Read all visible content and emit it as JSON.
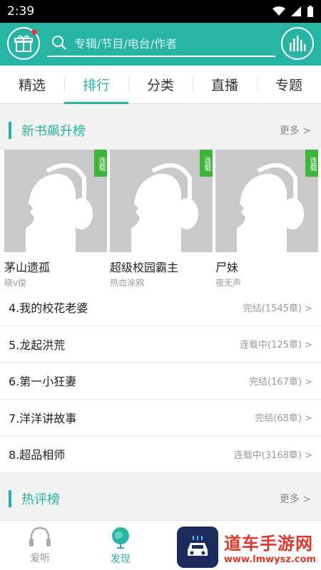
{
  "status": {
    "time": "2:39"
  },
  "search": {
    "placeholder": "专辑/节目/电台/作者"
  },
  "tabs": [
    "精选",
    "排行",
    "分类",
    "直播",
    "专题"
  ],
  "section1": {
    "title": "新书飙升榜",
    "more": "更多 >"
  },
  "cards": [
    {
      "title": "茅山遗孤",
      "author": "晓v俊",
      "badge": "连载"
    },
    {
      "title": "超级校园霸主",
      "author": "热血涂鸦",
      "badge": "连载"
    },
    {
      "title": "尸妹",
      "author": "夜无声",
      "badge": "连载"
    }
  ],
  "list": [
    {
      "name": "4.我的校花老婆",
      "status": "完结(1545章) >"
    },
    {
      "name": "5.龙起洪荒",
      "status": "连载中(125章) >"
    },
    {
      "name": "6.第一小狂妻",
      "status": "完结(167章) >"
    },
    {
      "name": "7.洋洋讲故事",
      "status": "完结(68章) >"
    },
    {
      "name": "8.超品相师",
      "status": "连载中(3168章) >"
    }
  ],
  "section2": {
    "title": "热评榜",
    "more": "更多 >"
  },
  "nav": [
    {
      "label": "爱听",
      "icon": "headphones-icon"
    },
    {
      "label": "发现",
      "icon": "globe-icon"
    }
  ],
  "watermark": {
    "title": "道车手游网",
    "url": "www.lmwysz.com"
  },
  "colors": {
    "accent": "#27b4a4",
    "badge": "#3fb43b"
  }
}
